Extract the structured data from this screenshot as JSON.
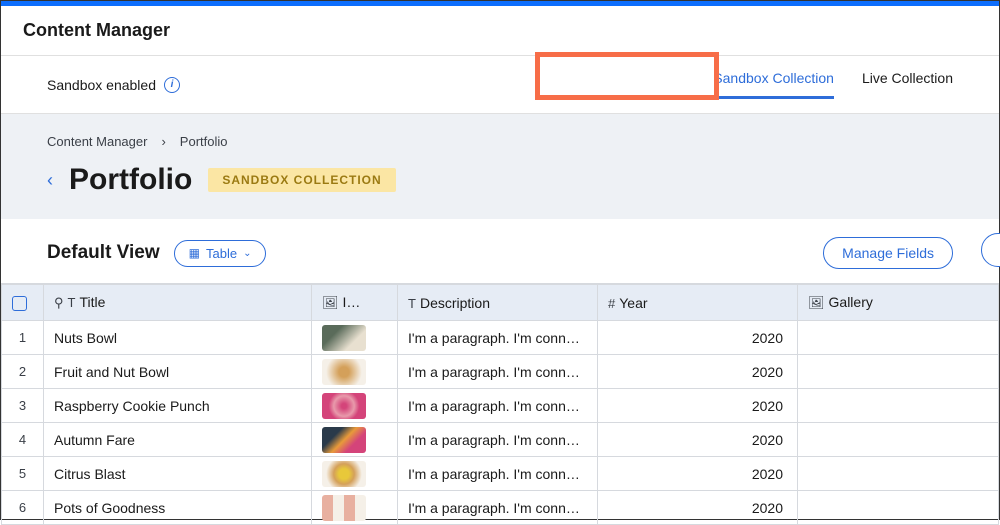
{
  "app_title": "Content Manager",
  "sandbox_label": "Sandbox enabled",
  "tabs": {
    "sandbox": "Sandbox Collection",
    "live": "Live Collection"
  },
  "breadcrumbs": {
    "root": "Content Manager",
    "current": "Portfolio"
  },
  "page_title": "Portfolio",
  "badge": "SANDBOX COLLECTION",
  "view": {
    "name": "Default View",
    "selector_label": "Table",
    "manage_fields": "Manage Fields"
  },
  "columns": {
    "title": "Title",
    "image": "I…",
    "description": "Description",
    "year": "Year",
    "gallery": "Gallery"
  },
  "rows": [
    {
      "n": "1",
      "title": "Nuts Bowl",
      "desc": "I'm a paragraph. I'm conn…",
      "year": "2020"
    },
    {
      "n": "2",
      "title": "Fruit and Nut Bowl",
      "desc": "I'm a paragraph. I'm conn…",
      "year": "2020"
    },
    {
      "n": "3",
      "title": "Raspberry Cookie Punch",
      "desc": "I'm a paragraph. I'm conn…",
      "year": "2020"
    },
    {
      "n": "4",
      "title": "Autumn Fare",
      "desc": "I'm a paragraph. I'm conn…",
      "year": "2020"
    },
    {
      "n": "5",
      "title": "Citrus Blast",
      "desc": "I'm a paragraph. I'm conn…",
      "year": "2020"
    },
    {
      "n": "6",
      "title": "Pots of Goodness",
      "desc": "I'm a paragraph. I'm conn…",
      "year": "2020"
    }
  ]
}
